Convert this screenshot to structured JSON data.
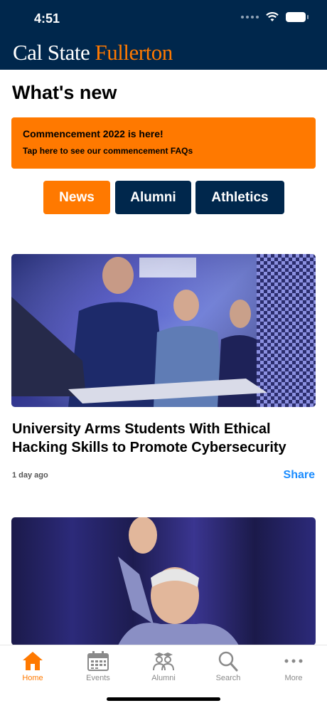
{
  "status_bar": {
    "time": "4:51"
  },
  "header": {
    "logo_part1": "Cal State",
    "logo_part2": "Fullerton"
  },
  "page_title": "What's new",
  "banner": {
    "title": "Commencement 2022 is here!",
    "subtitle": "Tap here to see our commencement FAQs"
  },
  "tabs": [
    {
      "label": "News",
      "active": true
    },
    {
      "label": "Alumni",
      "active": false
    },
    {
      "label": "Athletics",
      "active": false
    }
  ],
  "articles": [
    {
      "title": "University Arms Students With Ethical Hacking Skills to Promote Cybersecurity",
      "time": "1 day ago",
      "share": "Share"
    }
  ],
  "tabbar": [
    {
      "label": "Home",
      "icon": "home-icon",
      "selected": true
    },
    {
      "label": "Events",
      "icon": "calendar-icon",
      "selected": false
    },
    {
      "label": "Alumni",
      "icon": "graduates-icon",
      "selected": false
    },
    {
      "label": "Search",
      "icon": "search-icon",
      "selected": false
    },
    {
      "label": "More",
      "icon": "more-icon",
      "selected": false
    }
  ],
  "colors": {
    "navy": "#00274c",
    "orange": "#ff7900",
    "link": "#1a8cff"
  }
}
